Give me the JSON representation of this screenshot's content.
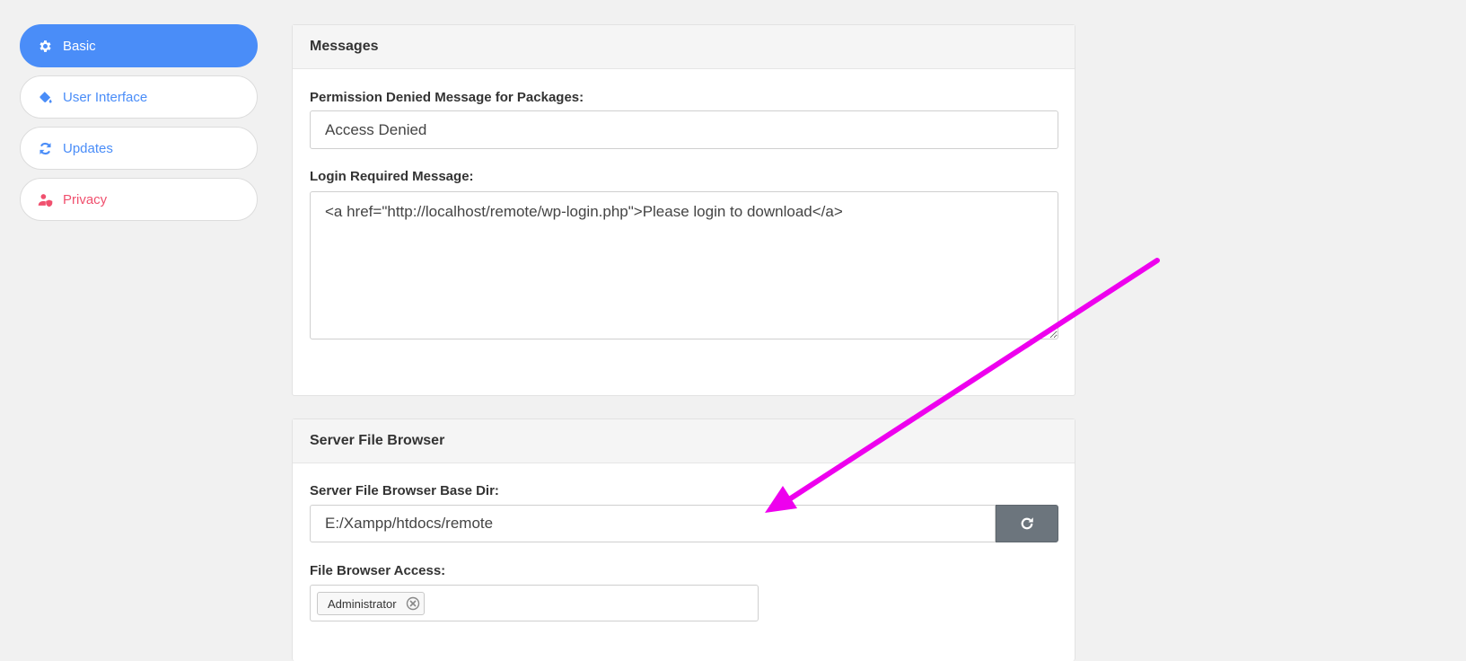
{
  "sidebar": {
    "items": [
      {
        "label": "Basic",
        "icon": "gear-icon",
        "state": "active"
      },
      {
        "label": "User Interface",
        "icon": "paint-bucket-icon",
        "state": "default"
      },
      {
        "label": "Updates",
        "icon": "refresh-icon",
        "state": "default"
      },
      {
        "label": "Privacy",
        "icon": "user-shield-icon",
        "state": "default"
      }
    ]
  },
  "messages": {
    "title": "Messages",
    "permission_label": "Permission Denied Message for Packages:",
    "permission_value": "Access Denied",
    "login_label": "Login Required Message:",
    "login_value": "<a href=\"http://localhost/remote/wp-login.php\">Please login to download</a>"
  },
  "file_browser": {
    "title": "Server File Browser",
    "base_dir_label": "Server File Browser Base Dir:",
    "base_dir_value": "E:/Xampp/htdocs/remote",
    "access_label": "File Browser Access:",
    "access_tags": [
      "Administrator"
    ]
  },
  "colors": {
    "accent": "#4a8df8",
    "danger": "#f0506e",
    "button_gray": "#6c757d",
    "annotation_arrow": "#ee00ee"
  }
}
